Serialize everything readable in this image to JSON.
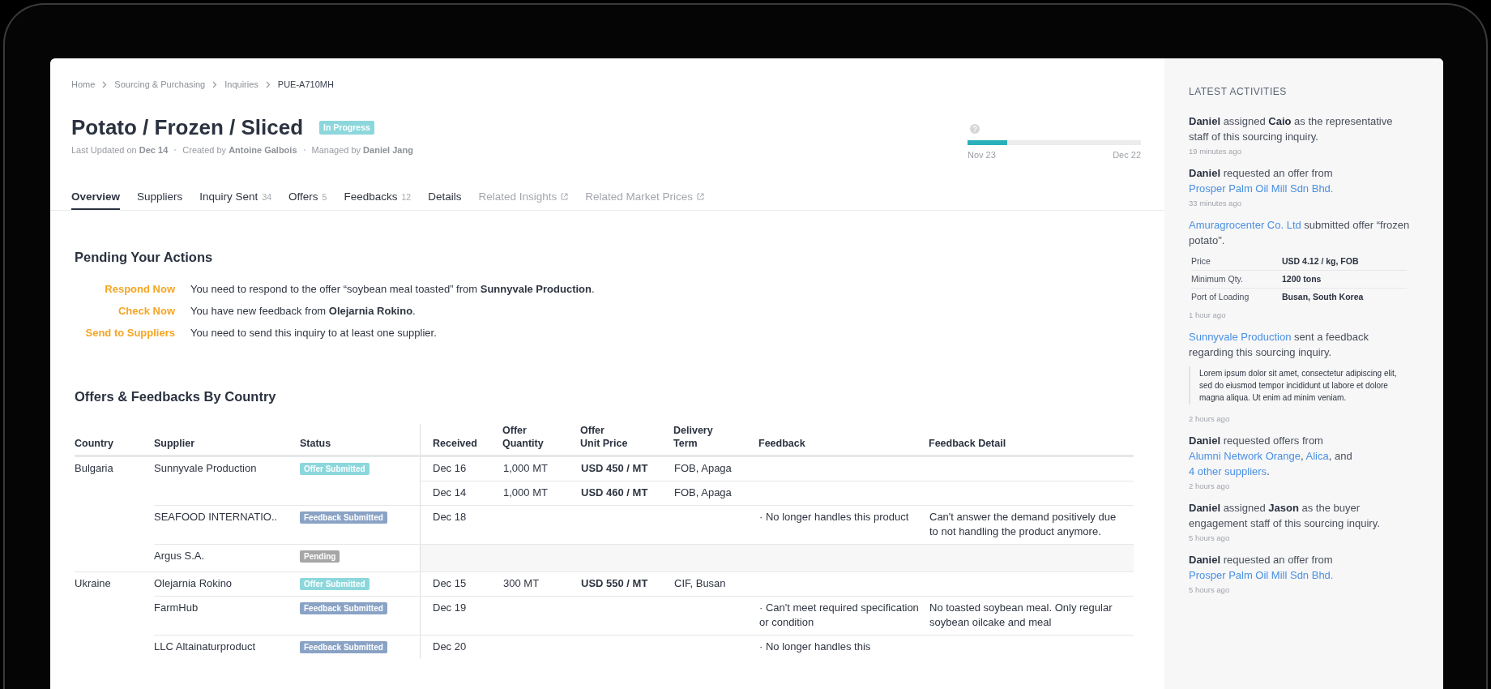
{
  "breadcrumb": [
    {
      "label": "Home",
      "current": false
    },
    {
      "label": "Sourcing & Purchasing",
      "current": false
    },
    {
      "label": "Inquiries",
      "current": false
    },
    {
      "label": "PUE-A710MH",
      "current": true
    }
  ],
  "title": "Potato / Frozen / Sliced",
  "status_badge": "In Progress",
  "meta": [
    {
      "label": "Last Updated on",
      "value": "Dec 14"
    },
    {
      "label": "Created by",
      "value": "Antoine Galbois"
    },
    {
      "label": "Managed by",
      "value": "Daniel Jang"
    }
  ],
  "timeline": {
    "level": 0.23,
    "start": "Nov 23",
    "end": "Dec 22"
  },
  "tabs": [
    {
      "label": "Overview",
      "kind": "internal",
      "selected": true
    },
    {
      "label": "Suppliers",
      "kind": "internal",
      "selected": false
    },
    {
      "label": "Inquiry Sent",
      "count": "34",
      "kind": "internal",
      "selected": false
    },
    {
      "label": "Offers",
      "count": "5",
      "kind": "internal",
      "selected": false
    },
    {
      "label": "Feedbacks",
      "count": "12",
      "kind": "internal",
      "selected": false
    },
    {
      "label": "Details",
      "kind": "internal",
      "selected": false
    },
    {
      "label": "Related Insights",
      "kind": "external",
      "selected": false
    },
    {
      "label": "Related Market Prices",
      "kind": "external",
      "selected": false
    }
  ],
  "pending_actions": {
    "title": "Pending Your Actions",
    "items": [
      {
        "action": "Respond Now",
        "message": "You need to respond to the offer “soybean meal toasted” from **Sunnyvale Production**."
      },
      {
        "action": "Check Now",
        "message": "You have new feedback from **Olejarnia Rokino**."
      },
      {
        "action": "Send to Suppliers",
        "message": "You need to send this inquiry to at least one supplier."
      }
    ]
  },
  "offers_table": {
    "title": "Offers & Feedbacks By Country",
    "columns": [
      "Country",
      "Supplier",
      "Status",
      "Received",
      "Offer\nQuantity",
      "Offer\nUnit Price",
      "Delivery\nTerm",
      "Feedback",
      "Feedback Detail"
    ],
    "groups": [
      {
        "country": "Bulgaria",
        "suppliers": [
          {
            "name": "Sunnyvale Production",
            "status": {
              "label": "Offer Submitted",
              "kind": "offer"
            },
            "entries": [
              {
                "received": "Dec 16",
                "quantity": "1,000 MT",
                "unit_price": "USD 450 / MT",
                "delivery_term": "FOB, Apaga"
              },
              {
                "received": "Dec 14",
                "quantity": "1,000 MT",
                "unit_price": "USD 460 / MT",
                "delivery_term": "FOB, Apaga"
              }
            ]
          },
          {
            "name": "SEAFOOD INTERNATIO..",
            "status": {
              "label": "Feedback Submitted",
              "kind": "feedback"
            },
            "entries": [
              {
                "received": "Dec 18",
                "feedback": "· No longer handles this product",
                "feedback_detail": "Can't answer the demand positively due to not handling the product anymore."
              }
            ]
          },
          {
            "name": "Argus S.A.",
            "status": {
              "label": "Pending",
              "kind": "pending"
            }
          }
        ]
      },
      {
        "country": "Ukraine",
        "suppliers": [
          {
            "name": "Olejarnia Rokino",
            "status": {
              "label": "Offer Submitted",
              "kind": "offer"
            },
            "entries": [
              {
                "received": "Dec 15",
                "quantity": "300 MT",
                "unit_price": "USD 550 / MT",
                "delivery_term": "CIF, Busan"
              }
            ]
          },
          {
            "name": "FarmHub",
            "status": {
              "label": "Feedback Submitted",
              "kind": "feedback"
            },
            "entries": [
              {
                "received": "Dec 19",
                "feedback": "· Can't meet required specification or condition",
                "feedback_detail": "No toasted soybean meal. Only regular soybean oilcake and meal"
              }
            ]
          },
          {
            "name": "LLC Altainaturproduct",
            "status": {
              "label": "Feedback Submitted",
              "kind": "feedback"
            },
            "entries": [
              {
                "received": "Dec 20",
                "feedback": "· No longer handles this"
              }
            ]
          }
        ]
      }
    ]
  },
  "latest_activities": {
    "title": "LATEST ACTIVITIES",
    "items": [
      {
        "parts": [
          {
            "text": "Daniel",
            "kind": "bold"
          },
          {
            "text": " assigned ",
            "kind": "plain"
          },
          {
            "text": "Caio",
            "kind": "bold"
          },
          {
            "text": " as the representative staff of this sourcing inquiry.",
            "kind": "plain"
          }
        ],
        "time": "19 minutes ago"
      },
      {
        "parts": [
          {
            "text": "Daniel",
            "kind": "bold"
          },
          {
            "text": " requested an offer from ",
            "kind": "plain"
          },
          {
            "text": "Prosper Palm Oil Mill Sdn Bhd.",
            "kind": "link"
          }
        ],
        "time": "33 minutes ago"
      },
      {
        "parts": [
          {
            "text": "Amuragrocenter Co. Ltd",
            "kind": "link"
          },
          {
            "text": " submitted offer “frozen potato\".",
            "kind": "plain"
          }
        ],
        "details": [
          {
            "label": "Price",
            "value": "USD 4.12 / kg, FOB"
          },
          {
            "label": "Minimum Qty.",
            "value": "1200 tons"
          },
          {
            "label": "Port of Loading",
            "value": "Busan, South Korea"
          }
        ],
        "time": "1 hour ago"
      },
      {
        "parts": [
          {
            "text": "Sunnyvale Production",
            "kind": "link"
          },
          {
            "text": " sent a feedback regarding this sourcing inquiry.",
            "kind": "plain"
          }
        ],
        "quote": "Lorem ipsum dolor sit amet, consectetur adipiscing elit, sed do eiusmod tempor incididunt ut labore et dolore magna aliqua. Ut enim ad minim veniam.",
        "time": "2 hours ago"
      },
      {
        "parts": [
          {
            "text": "Daniel",
            "kind": "bold"
          },
          {
            "text": " requested offers from ",
            "kind": "plain"
          },
          {
            "text": "Alumni Network Orange",
            "kind": "link"
          },
          {
            "text": ", ",
            "kind": "plain"
          },
          {
            "text": "Alica",
            "kind": "link"
          },
          {
            "text": ", and ",
            "kind": "plain"
          },
          {
            "text": "4 other suppliers",
            "kind": "link"
          },
          {
            "text": ".",
            "kind": "plain"
          }
        ],
        "time": "2 hours ago"
      },
      {
        "parts": [
          {
            "text": "Daniel",
            "kind": "bold"
          },
          {
            "text": " assigned ",
            "kind": "plain"
          },
          {
            "text": "Jason",
            "kind": "bold"
          },
          {
            "text": " as the buyer engagement staff of this sourcing inquiry.",
            "kind": "plain"
          }
        ],
        "time": "5 hours ago"
      },
      {
        "parts": [
          {
            "text": "Daniel",
            "kind": "bold"
          },
          {
            "text": " requested an offer from ",
            "kind": "plain"
          },
          {
            "text": "Prosper Palm Oil Mill Sdn Bhd.",
            "kind": "link"
          }
        ],
        "time": "5 hours ago"
      }
    ]
  }
}
